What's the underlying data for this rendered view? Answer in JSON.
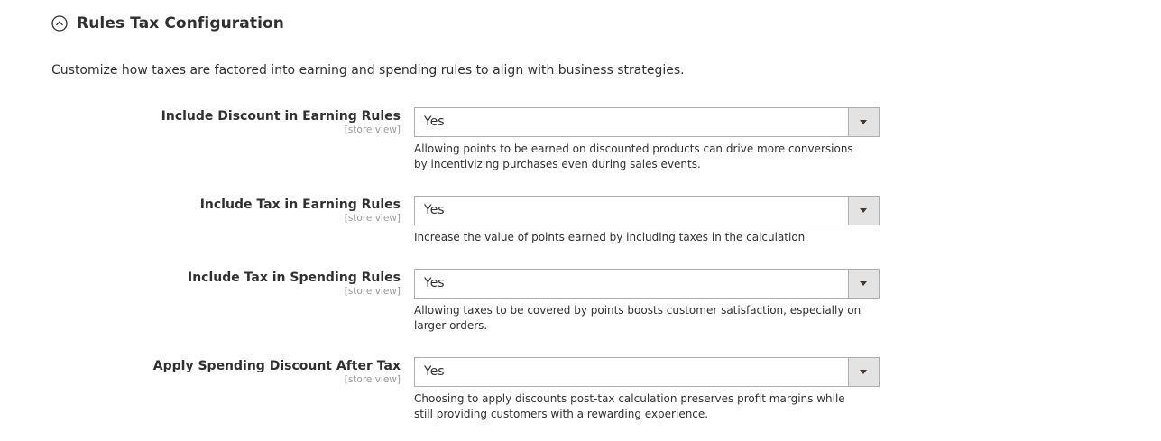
{
  "section": {
    "title": "Rules Tax Configuration",
    "description": "Customize how taxes are factored into earning and spending rules to align with business strategies.",
    "toggle_icon": "chevron-up-circle-icon"
  },
  "fields": [
    {
      "label": "Include Discount in Earning Rules",
      "scope": "[store view]",
      "value": "Yes",
      "note": "Allowing points to be earned on discounted products can drive more conversions by incentivizing purchases even during sales events."
    },
    {
      "label": "Include Tax in Earning Rules",
      "scope": "[store view]",
      "value": "Yes",
      "note": "Increase the value of points earned by including taxes in the calculation"
    },
    {
      "label": "Include Tax in Spending Rules",
      "scope": "[store view]",
      "value": "Yes",
      "note": "Allowing taxes to be covered by points boosts customer satisfaction, especially on larger orders."
    },
    {
      "label": "Apply Spending Discount After Tax",
      "scope": "[store view]",
      "value": "Yes",
      "note": "Choosing to apply discounts post-tax calculation preserves profit margins while still providing customers with a rewarding experience."
    }
  ]
}
